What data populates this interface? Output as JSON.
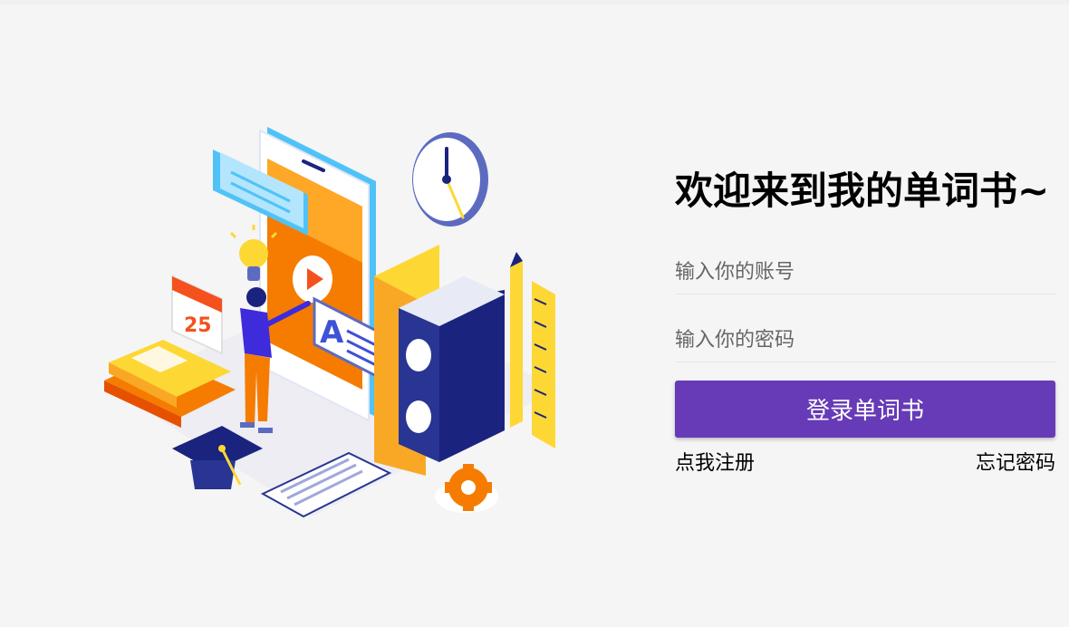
{
  "login": {
    "title": "欢迎来到我的单词书~",
    "account_placeholder": "输入你的账号",
    "password_placeholder": "输入你的密码",
    "login_button": "登录单词书",
    "register_link": "点我注册",
    "forgot_link": "忘记密码"
  },
  "illustration": {
    "calendar_number": "25"
  },
  "colors": {
    "primary": "#673ab7",
    "background": "#f5f5f5",
    "orange": "#f57c00",
    "yellow": "#fdd835",
    "navy": "#1a237e",
    "blue": "#3f51d5"
  }
}
